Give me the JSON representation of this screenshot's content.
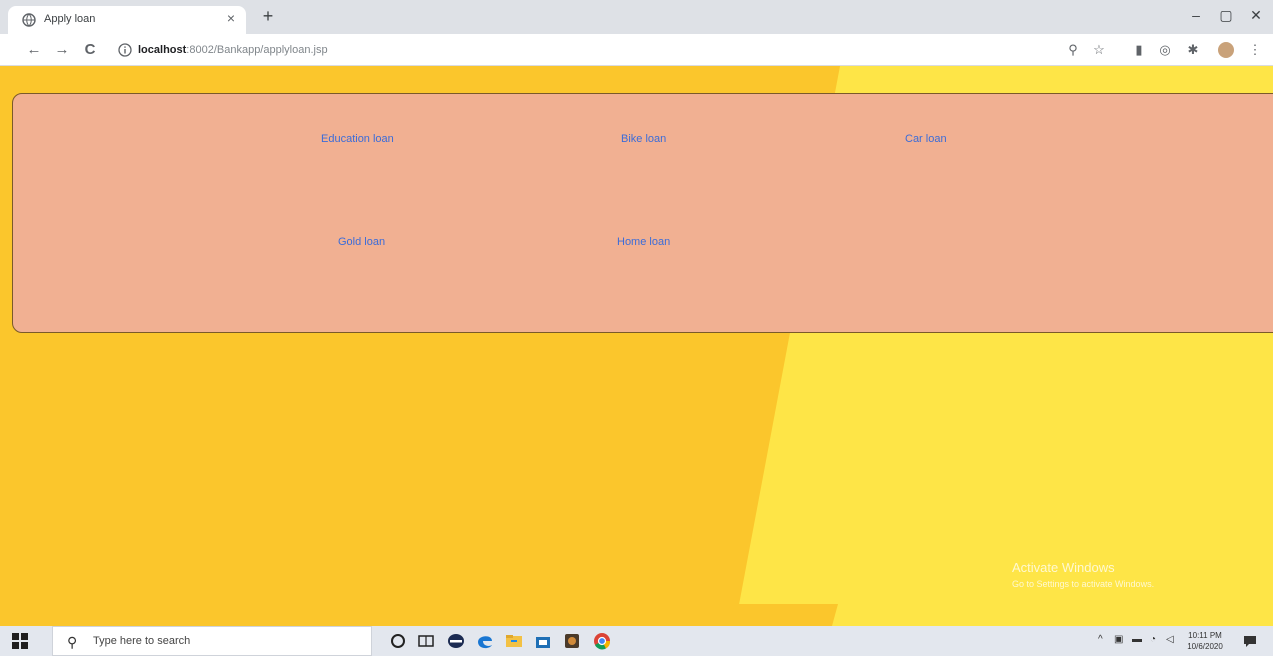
{
  "browser": {
    "tab_title": "Apply loan",
    "tab_close": "×",
    "new_tab": "+",
    "url_host": "localhost",
    "url_path": ":8002/Bankapp/applyloan.jsp",
    "window_controls": {
      "minimize": "–",
      "maximize": "▢",
      "close": "✕"
    },
    "nav": {
      "back": "←",
      "forward": "→",
      "reload": "C"
    },
    "toolbar_icons": [
      "zoom-icon",
      "star-icon",
      "extension-icon",
      "extension-icon",
      "puzzle-icon",
      "profile-avatar",
      "menu-icon"
    ]
  },
  "loans": {
    "education": "Education loan",
    "bike": "Bike loan",
    "car": "Car loan",
    "gold": "Gold loan",
    "home": "Home loan"
  },
  "watermark": {
    "title": "Activate Windows",
    "subtitle": "Go to Settings to activate Windows."
  },
  "taskbar": {
    "search_placeholder": "Type here to search",
    "time": "10:11 PM",
    "date": "10/6/2020"
  },
  "colors": {
    "page_orange": "#fbc62c",
    "page_yellow": "#fee547",
    "panel": "#f1b092",
    "link": "#3b6cd9"
  }
}
